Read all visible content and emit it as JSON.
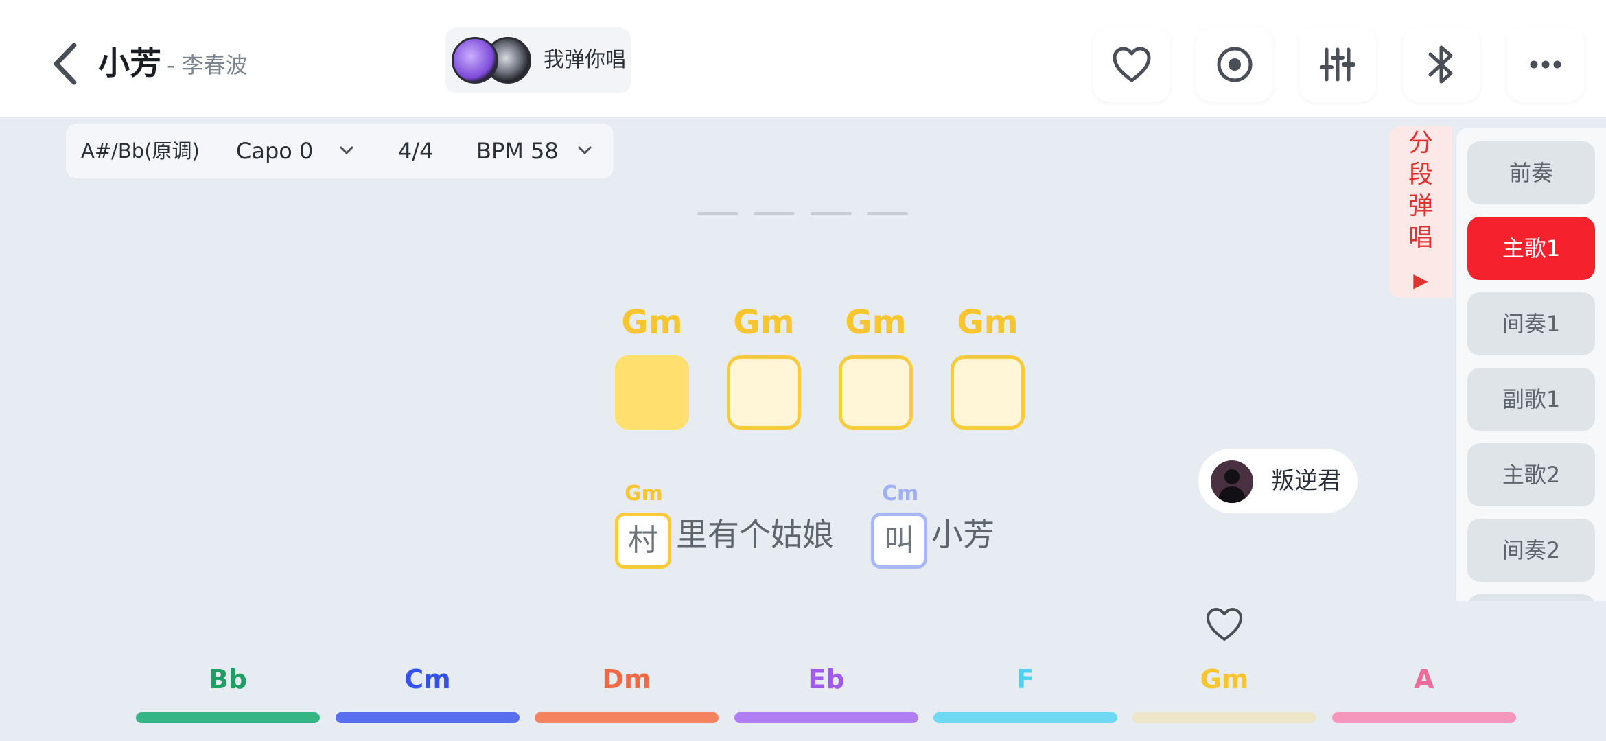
{
  "header": {
    "song_title": "小芳",
    "song_artist": "- 李春波",
    "duet_label": "我弹你唱"
  },
  "icons": {
    "back": "chevron-left-icon",
    "favorite": "heart-icon",
    "record": "record-icon",
    "mixer": "sliders-icon",
    "bluetooth": "bluetooth-icon",
    "more": "more-icon"
  },
  "settings": {
    "key": "A#/Bb(原调)",
    "capo": "Capo 0",
    "meter": "4/4",
    "bpm": "BPM 58"
  },
  "beats": {
    "chords": [
      "Gm",
      "Gm",
      "Gm",
      "Gm"
    ],
    "active_index": 0
  },
  "lyrics": [
    {
      "chord": "Gm",
      "first_char": "村",
      "rest": "里有个姑娘",
      "color": "#f7c62f"
    },
    {
      "chord": "Cm",
      "first_char": "叫",
      "rest": "小芳",
      "color": "#9fb0f5"
    }
  ],
  "performer": {
    "name": "叛逆君"
  },
  "section_tab": {
    "label": "分\n段\n弹\n唱",
    "play_glyph": "▶"
  },
  "sections": [
    {
      "label": "前奏",
      "active": false
    },
    {
      "label": "主歌1",
      "active": true
    },
    {
      "label": "间奏1",
      "active": false
    },
    {
      "label": "副歌1",
      "active": false
    },
    {
      "label": "主歌2",
      "active": false
    },
    {
      "label": "间奏2",
      "active": false
    }
  ],
  "chord_bar": [
    {
      "name": "Bb",
      "color": "#1f9e63",
      "bar": "#35b584"
    },
    {
      "name": "Cm",
      "color": "#3552e8",
      "bar": "#5a6fef"
    },
    {
      "name": "Dm",
      "color": "#f06a45",
      "bar": "#f6835f"
    },
    {
      "name": "Eb",
      "color": "#a05af0",
      "bar": "#b07ef2"
    },
    {
      "name": "F",
      "color": "#4fd1f2",
      "bar": "#6fd8f3"
    },
    {
      "name": "Gm",
      "color": "#f7c62f",
      "bar": "#ede6c8"
    },
    {
      "name": "A",
      "color": "#f26a9a",
      "bar": "#f597ba"
    }
  ]
}
